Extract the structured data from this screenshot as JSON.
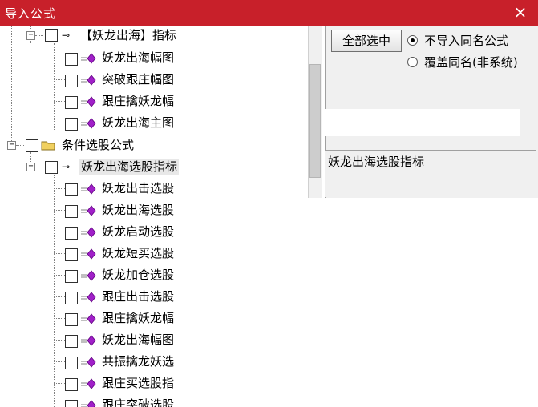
{
  "window": {
    "title": "导入公式",
    "close_label": "×"
  },
  "tree": {
    "group_indicator": "【妖龙出海】指标",
    "group_indicator_children": [
      "妖龙出海幅图",
      "突破跟庄幅图",
      "跟庄擒妖龙幅",
      "妖龙出海主图"
    ],
    "group_folder": "条件选股公式",
    "group_selection": "妖龙出海选股指标",
    "group_selection_children": [
      "妖龙出击选股",
      "妖龙出海选股",
      "妖龙启动选股",
      "妖龙短买选股",
      "妖龙加仓选股",
      "跟庄出击选股",
      "跟庄擒妖龙幅",
      "妖龙出海幅图",
      "共振擒龙妖选",
      "跟庄买选股指",
      "跟庄突破选股"
    ]
  },
  "controls": {
    "select_all_button": "全部选中",
    "radio_options": [
      {
        "label": "不导入同名公式",
        "selected": true
      },
      {
        "label": "覆盖同名(非系统)",
        "selected": false
      }
    ]
  },
  "info": {
    "description": "妖龙出海选股指标"
  },
  "colors": {
    "title_bar": "#c8202a",
    "formula_icon": "#a020c8",
    "folder_icon": "#f0d060"
  },
  "icons": {
    "expander_minus": "−",
    "key_icon": "⊸"
  }
}
